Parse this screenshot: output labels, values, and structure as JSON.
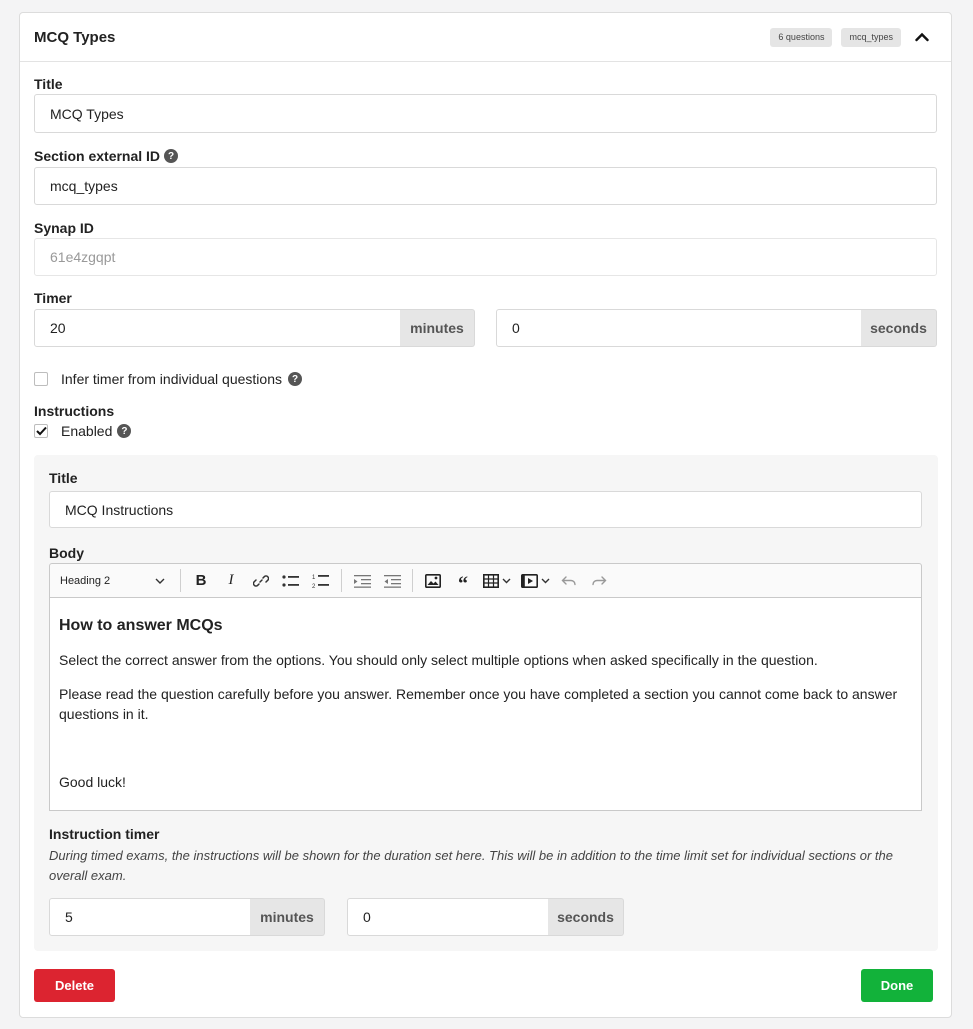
{
  "header": {
    "title": "MCQ Types",
    "question_count_badge": "6 questions",
    "external_id_badge": "mcq_types"
  },
  "fields": {
    "title_label": "Title",
    "title_value": "MCQ Types",
    "external_id_label": "Section external ID",
    "external_id_value": "mcq_types",
    "synap_id_label": "Synap ID",
    "synap_id_value": "61e4zgqpt",
    "timer_label": "Timer",
    "timer_minutes_value": "20",
    "timer_minutes_addon": "minutes",
    "timer_seconds_value": "0",
    "timer_seconds_addon": "seconds",
    "infer_timer_label": "Infer timer from individual questions",
    "infer_timer_checked": false,
    "instructions_label": "Instructions",
    "enabled_label": "Enabled",
    "enabled_checked": true
  },
  "instructions": {
    "title_label": "Title",
    "title_value": "MCQ Instructions",
    "body_label": "Body",
    "toolbar": {
      "heading_select": "Heading 2",
      "icons": [
        "bold-icon",
        "italic-icon",
        "link-icon",
        "bulleted-list-icon",
        "numbered-list-icon",
        "indent-icon",
        "outdent-icon",
        "image-icon",
        "blockquote-icon",
        "table-icon",
        "media-icon",
        "undo-icon",
        "redo-icon"
      ]
    },
    "body": {
      "heading": "How to answer MCQs",
      "para1": "Select the correct answer from the options. You should only select multiple options when asked specifically in the question.",
      "para2": "Please read the question carefully before you answer. Remember once you have completed a section you cannot come back to answer questions in it.",
      "para3": "Good luck!"
    },
    "timer_label": "Instruction timer",
    "timer_help": "During timed exams, the instructions will be shown for the duration set here. This will be in addition to the time limit set for individual sections or the overall exam.",
    "timer_minutes_value": "5",
    "timer_minutes_addon": "minutes",
    "timer_seconds_value": "0",
    "timer_seconds_addon": "seconds"
  },
  "actions": {
    "delete_label": "Delete",
    "done_label": "Done"
  },
  "colors": {
    "delete": "#dc2430",
    "done": "#12b23a"
  }
}
